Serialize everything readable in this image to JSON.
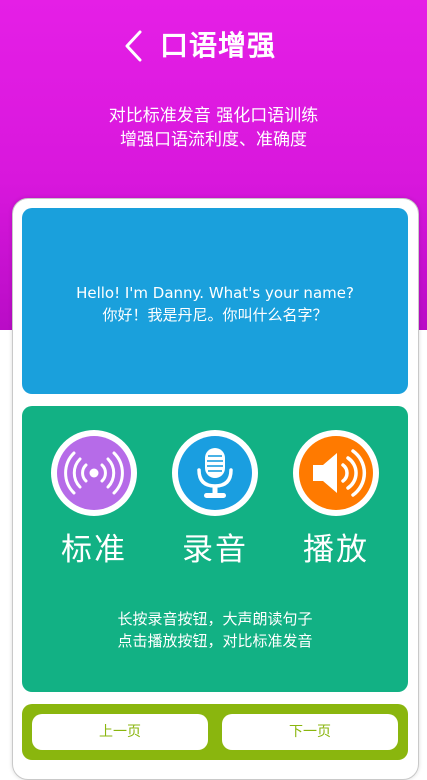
{
  "header": {
    "title": "口语增强",
    "back_icon": "chevron-left-icon"
  },
  "intro": {
    "line1": "对比标准发音  强化口语训练",
    "line2": "增强口语流利度、准确度"
  },
  "sentence": {
    "english": "Hello! I'm Danny. What's your name?",
    "chinese": "你好！我是丹尼。你叫什么名字？"
  },
  "controls": {
    "standard": {
      "label": "标准",
      "icon": "broadcast-icon",
      "color": "#b66be8"
    },
    "record": {
      "label": "录音",
      "icon": "microphone-icon",
      "color": "#1a9ee0"
    },
    "play": {
      "label": "播放",
      "icon": "speaker-icon",
      "color": "#ff7a00"
    }
  },
  "hint": {
    "line1": "长按录音按钮，大声朗读句子",
    "line2": "点击播放按钮，对比标准发音"
  },
  "nav": {
    "prev_label": "上一页",
    "next_label": "下一页"
  },
  "colors": {
    "hero": "#d817dc",
    "sentence_panel": "#1aa0dc",
    "control_panel": "#12b184",
    "nav_bar": "#8ab60e"
  }
}
